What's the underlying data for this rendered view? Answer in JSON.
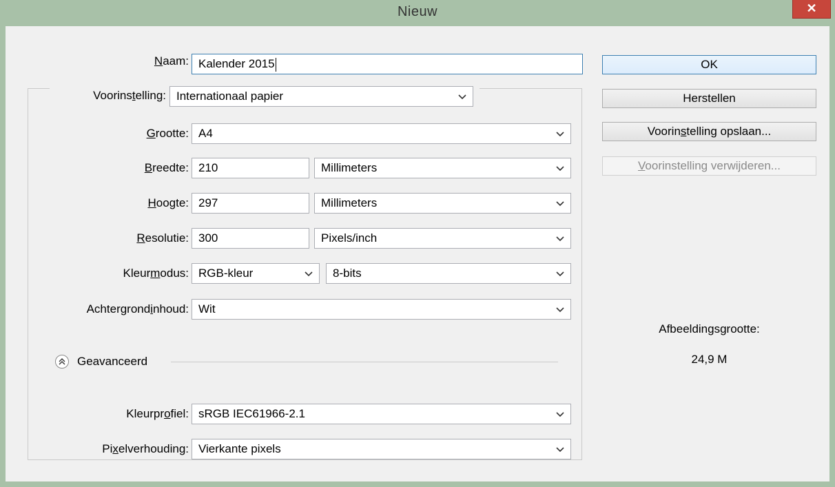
{
  "window": {
    "title": "Nieuw",
    "close_glyph": "✕"
  },
  "form": {
    "name": {
      "label_pre": "",
      "label_key": "N",
      "label_post": "aam:",
      "value": "Kalender 2015"
    },
    "preset": {
      "label_pre": "Voorins",
      "label_key": "t",
      "label_post": "elling:",
      "value": "Internationaal papier"
    },
    "size": {
      "label_pre": "",
      "label_key": "G",
      "label_post": "rootte:",
      "value": "A4"
    },
    "width": {
      "label_pre": "",
      "label_key": "B",
      "label_post": "reedte:",
      "value": "210",
      "unit": "Millimeters"
    },
    "height": {
      "label_pre": "",
      "label_key": "H",
      "label_post": "oogte:",
      "value": "297",
      "unit": "Millimeters"
    },
    "resolution": {
      "label_pre": "",
      "label_key": "R",
      "label_post": "esolutie:",
      "value": "300",
      "unit": "Pixels/inch"
    },
    "color_mode": {
      "label_pre": "Kleur",
      "label_key": "m",
      "label_post": "odus:",
      "value": "RGB-kleur",
      "depth": "8-bits"
    },
    "background": {
      "label_pre": "Achtergrond",
      "label_key": "i",
      "label_post": "nhoud:",
      "value": "Wit"
    },
    "advanced": {
      "label": "Geavanceerd",
      "icon": "collapse-up-icon"
    },
    "color_profile": {
      "label_pre": "Kleurpr",
      "label_key": "o",
      "label_post": "fiel:",
      "value": "sRGB IEC61966-2.1"
    },
    "pixel_ratio": {
      "label_pre": "Pi",
      "label_key": "x",
      "label_post": "elverhouding:",
      "value": "Vierkante pixels"
    }
  },
  "buttons": {
    "ok": "OK",
    "reset": "Herstellen",
    "save_pre": "Voorin",
    "save_key": "s",
    "save_post": "telling opslaan...",
    "delete_pre": "",
    "delete_key": "V",
    "delete_post": "oorinstelling verwijderen..."
  },
  "info": {
    "size_label": "Afbeeldingsgrootte:",
    "size_value": "24,9 M"
  }
}
